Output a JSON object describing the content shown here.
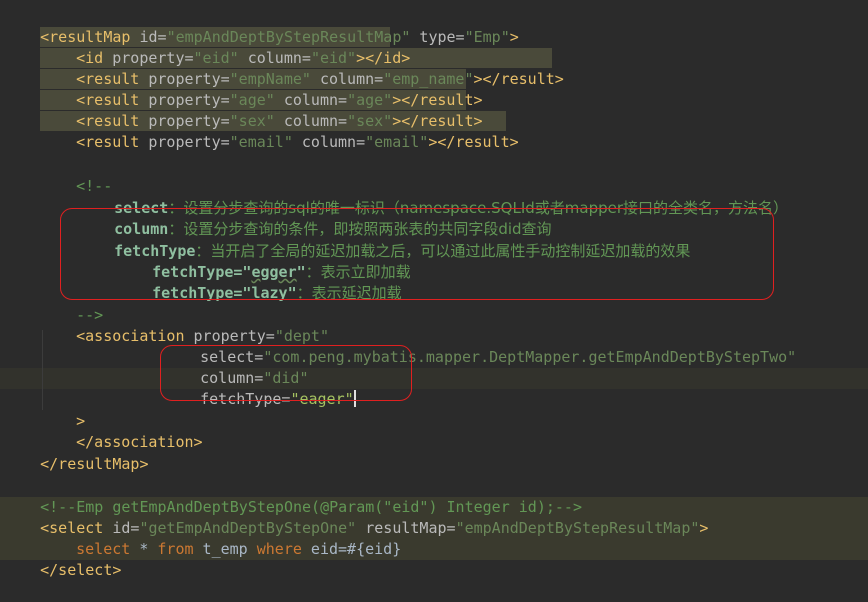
{
  "code": {
    "result_map_open": {
      "tag_open": "<resultMap",
      "id_attr": " id=",
      "id_val": "\"empAndDeptByStepResultMap\"",
      "type_attr": " type=",
      "type_val": "\"Emp\"",
      "tag_close": ">"
    },
    "id_line": {
      "tag_open": "<id",
      "prop_attr": " property=",
      "prop_val": "\"eid\"",
      "col_attr": " column=",
      "col_val": "\"eid\"",
      "tag_close": "></id>"
    },
    "results": [
      {
        "prop_val": "\"empName\"",
        "col_val": "\"emp_name\""
      },
      {
        "prop_val": "\"age\"",
        "col_val": "\"age\""
      },
      {
        "prop_val": "\"sex\"",
        "col_val": "\"sex\""
      },
      {
        "prop_val": "\"email\"",
        "col_val": "\"email\""
      }
    ],
    "result_tag_open": "<result",
    "result_prop_attr": " property=",
    "result_col_attr": " column=",
    "result_tag_close": "></result>",
    "comment_open": "<!--",
    "comment_select_key": "select",
    "comment_select_text": "：设置分步查询的sql的唯一标识（namespace.SQLId或者mapper接口的全类名，方法名）",
    "comment_column_key": "column",
    "comment_column_text": "：设置分步查询的条件，即按照两张表的共同字段did查询",
    "comment_fetch_key": "fetchType",
    "comment_fetch_text": "：当开启了全局的延迟加载之后，可以通过此属性手动控制延迟加载的效果",
    "comment_eager_key": "fetchType=\"",
    "comment_eager_word": "egger",
    "comment_eager_end": "\"",
    "comment_eager_text": "：表示立即加载",
    "comment_lazy_key": "fetchType=\"lazy\"",
    "comment_lazy_text": "：表示延迟加载",
    "comment_close": "-->",
    "association_open": {
      "tag_open": "<association",
      "prop_attr": " property=",
      "prop_val": "\"dept\""
    },
    "association_select": {
      "attr": "select=",
      "val": "\"com.peng.mybatis.mapper.DeptMapper.getEmpAndDeptByStepTwo\""
    },
    "association_column": {
      "attr": "column=",
      "val": "\"did\""
    },
    "association_fetch": {
      "attr": "fetchType=",
      "val": "\"eager\""
    },
    "association_gt": ">",
    "association_close": "</association>",
    "result_map_close": "</resultMap>",
    "method_comment": "<!--Emp getEmpAndDeptByStepOne(@Param(\"eid\") Integer id);-->",
    "select_open": {
      "tag_open": "<select",
      "id_attr": " id=",
      "id_val": "\"getEmpAndDeptByStepOne\"",
      "rm_attr": " resultMap=",
      "rm_val": "\"empAndDeptByStepResultMap\"",
      "tag_close": ">"
    },
    "sql": {
      "kw_select": "select",
      "star": " * ",
      "kw_from": "from",
      "table": " t_emp ",
      "kw_where": "where",
      "cond": " eid=#{eid}"
    },
    "select_close": "</select>"
  },
  "colors": {
    "background": "#2b2b2b",
    "tag": "#e8bf6a",
    "attribute_value": "#6a8759",
    "comment": "#629755",
    "keyword": "#cc7832",
    "annotation_box": "#e02020"
  }
}
